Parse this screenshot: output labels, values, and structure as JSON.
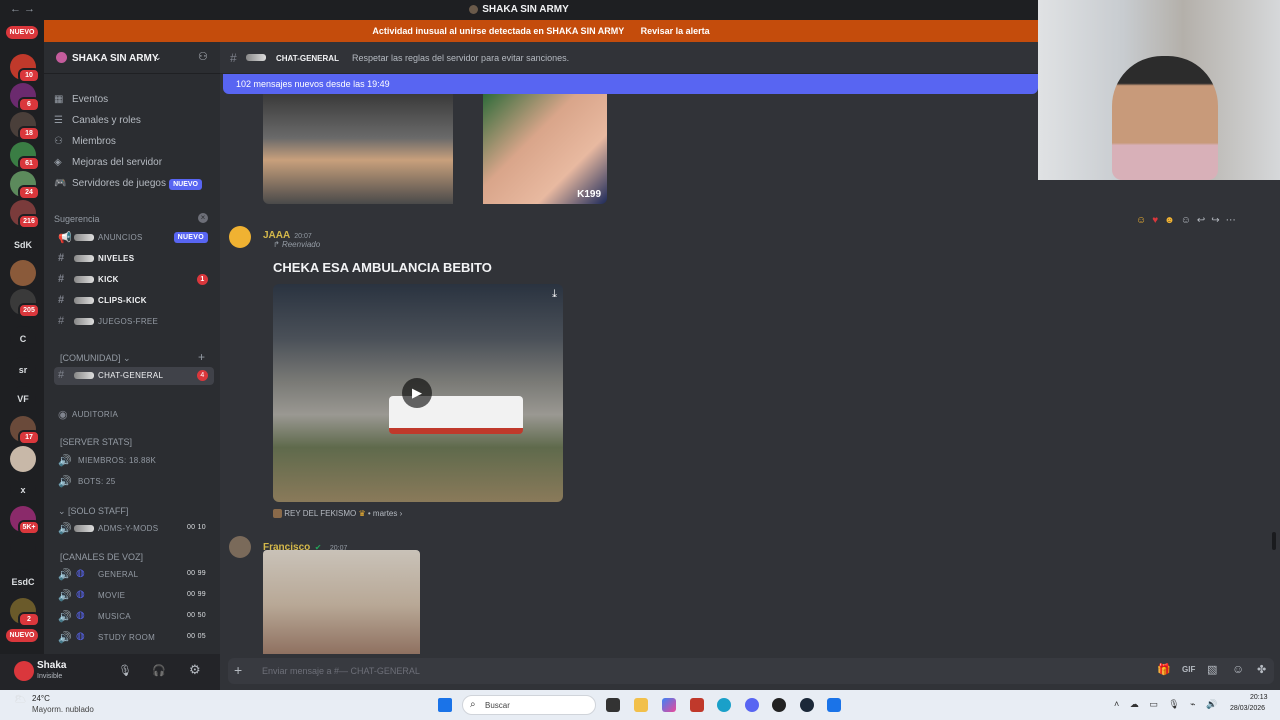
{
  "window": {
    "title": "SHAKA SIN ARMY"
  },
  "alert": {
    "message": "Actividad inusual al unirse detectada en SHAKA SIN ARMY",
    "action": "Revisar la alerta"
  },
  "guilds": {
    "new_top": "NUEVO",
    "new_bottom": "NUEVO",
    "items": [
      {
        "label": "",
        "badge": "10",
        "color": "#c0392b"
      },
      {
        "label": "",
        "badge": "6",
        "color": "#6b2a6e"
      },
      {
        "label": "",
        "badge": "18",
        "color": "#4a3f3a"
      },
      {
        "label": "",
        "badge": "61",
        "color": "#3a7d44"
      },
      {
        "label": "",
        "badge": "24",
        "color": "#5c8a5c"
      },
      {
        "label": "",
        "badge": "216",
        "color": "#7a3b3b"
      },
      {
        "label": "SdK",
        "badge": "",
        "color": "#1e1f22"
      },
      {
        "label": "",
        "badge": "",
        "color": "#8a5a3a"
      },
      {
        "label": "",
        "badge": "205",
        "color": "#3a3a3a"
      },
      {
        "label": "C",
        "badge": "",
        "color": "#1e1f22"
      },
      {
        "label": "sr",
        "badge": "",
        "color": "#1e1f22"
      },
      {
        "label": "VF",
        "badge": "",
        "color": "#1e1f22"
      },
      {
        "label": "",
        "badge": "17",
        "color": "#6a4a3a"
      },
      {
        "label": "",
        "badge": "",
        "color": "#c8b8a8"
      },
      {
        "label": "x",
        "badge": "",
        "color": "#1e1f22"
      },
      {
        "label": "",
        "badge": "5K+",
        "color": "#8a2a6a"
      },
      {
        "label": "",
        "badge": "",
        "color": "#1e1f22"
      },
      {
        "label": "EsdC",
        "badge": "",
        "color": "#1e1f22"
      },
      {
        "label": "",
        "badge": "2",
        "color": "#6a5a2a"
      }
    ]
  },
  "sidebar": {
    "server_name": "SHAKA SIN ARMY",
    "top_items": [
      {
        "icon": "calendar-icon",
        "label": "Eventos",
        "badge": ""
      },
      {
        "icon": "browse-channels-icon",
        "label": "Canales y roles",
        "badge": ""
      },
      {
        "icon": "members-icon",
        "label": "Miembros",
        "badge": ""
      },
      {
        "icon": "boost-icon",
        "label": "Mejoras del servidor",
        "badge": ""
      },
      {
        "icon": "game-servers-icon",
        "label": "Servidores de juegos",
        "badge": "NUEVO"
      }
    ],
    "suggestion_label": "Sugerencia",
    "suggested": [
      {
        "name": "ANUNCIOS",
        "prefix": "꒰",
        "badge": "NUEVO",
        "count": "",
        "bold": false
      },
      {
        "name": "NIVELES",
        "prefix": "꒰",
        "badge": "",
        "count": "",
        "bold": true
      },
      {
        "name": "KICK",
        "prefix": "꒰",
        "badge": "",
        "count": "1",
        "bold": true
      },
      {
        "name": "CLIPS-KICK",
        "prefix": "꒰",
        "badge": "",
        "count": "",
        "bold": true
      },
      {
        "name": "JUEGOS-FREE",
        "prefix": "꒰",
        "badge": "",
        "count": "",
        "bold": false
      }
    ],
    "community_label": "[COMUNIDAD]",
    "active_channel": {
      "name": "CHAT-GENERAL",
      "count": "4"
    },
    "auditoria": "Auditoria",
    "stats_label": "[SERVER STATS]",
    "stats": [
      "Miembros: 18.88k",
      "Bots: 25"
    ],
    "staff_label": "[SOLO STAFF]",
    "staff_channel": {
      "name": "ADMS-Y-MODS",
      "a": "00",
      "b": "10"
    },
    "voice_label": "[CANALES DE VOZ]",
    "voice": [
      {
        "name": "GENERAL",
        "a": "00",
        "b": "99"
      },
      {
        "name": "MOVIE",
        "a": "00",
        "b": "99"
      },
      {
        "name": "MUSICA",
        "a": "00",
        "b": "50"
      },
      {
        "name": "STUDY ROOM",
        "a": "00",
        "b": "05"
      }
    ]
  },
  "user": {
    "name": "Shaka",
    "status": "Invisible"
  },
  "chat": {
    "channel_name": "CHAT-GENERAL",
    "topic": "Respetar las reglas del servidor para evitar sanciones.",
    "new_messages": "102 mensajes nuevos desde las 19:49",
    "messages": [
      {
        "author": "JAAA",
        "time": "20:07",
        "forwarded": "Reenviado",
        "title": "CHEKA ESA AMBULANCIA BEBITO",
        "source": "REY DEL FEKISMO",
        "source_date": "martes",
        "author_color": "#d4b84a"
      },
      {
        "author": "Francisco",
        "time": "20:07",
        "author_color": "#d4b84a"
      }
    ],
    "prev_image_tag": "K199"
  },
  "composer": {
    "placeholder": "Enviar mensaje a #—  CHAT-GENERAL"
  },
  "taskbar": {
    "weather_temp": "24°C",
    "weather_desc": "Mayorm. nublado",
    "search": "Buscar",
    "time": "20:13",
    "date": "28/03/2026"
  },
  "colors": {
    "accent": "#5865f2",
    "alert": "#c44c0c",
    "danger": "#da373c"
  }
}
